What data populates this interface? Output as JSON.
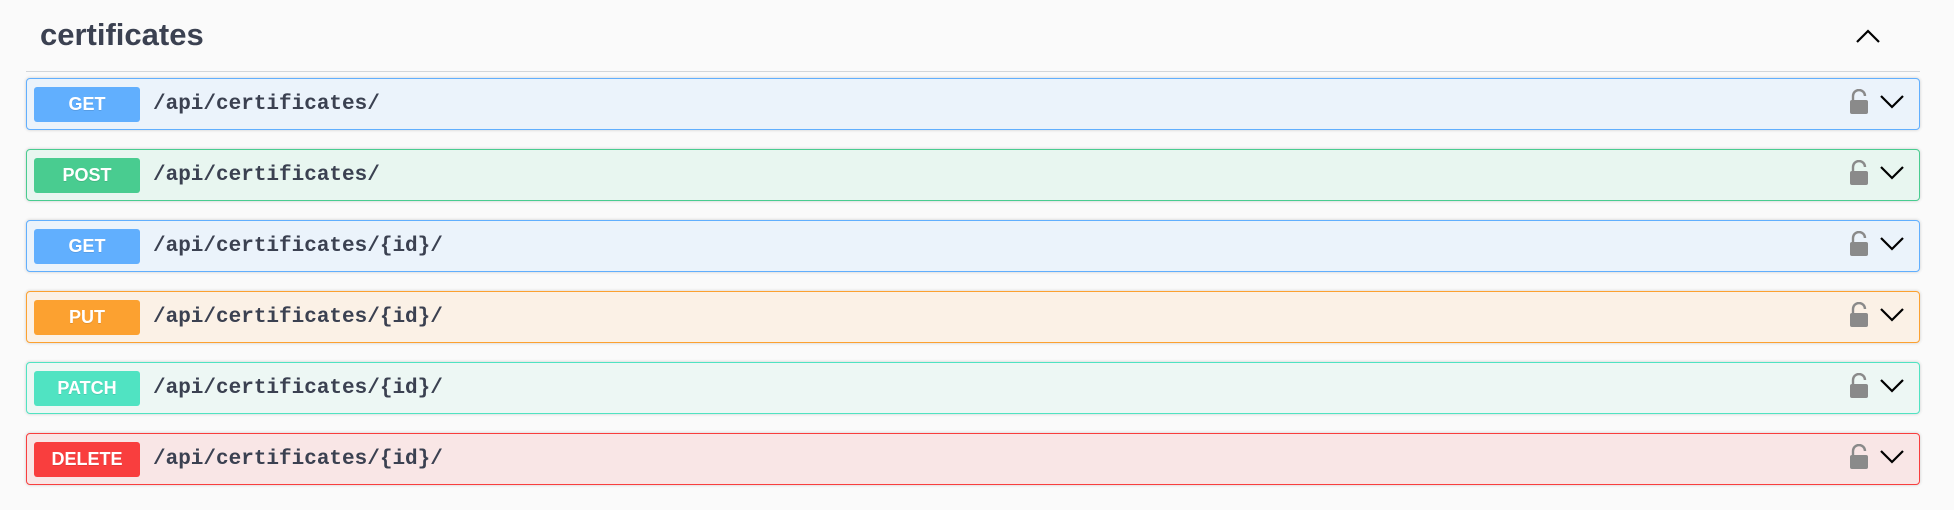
{
  "tag": {
    "title": "certificates"
  },
  "operations": [
    {
      "method": "GET",
      "path": "/api/certificates/",
      "color": "#61affe",
      "bg": "#ebf3fb",
      "border": "#61affe"
    },
    {
      "method": "POST",
      "path": "/api/certificates/",
      "color": "#49cc90",
      "bg": "#e8f6f0",
      "border": "#49cc90"
    },
    {
      "method": "GET",
      "path": "/api/certificates/{id}/",
      "color": "#61affe",
      "bg": "#ebf3fb",
      "border": "#61affe"
    },
    {
      "method": "PUT",
      "path": "/api/certificates/{id}/",
      "color": "#fca130",
      "bg": "#fbf1e6",
      "border": "#fca130"
    },
    {
      "method": "PATCH",
      "path": "/api/certificates/{id}/",
      "color": "#50e3c2",
      "bg": "#edf7f4",
      "border": "#50e3c2"
    },
    {
      "method": "DELETE",
      "path": "/api/certificates/{id}/",
      "color": "#f93e3e",
      "bg": "#f9e6e6",
      "border": "#f93e3e"
    }
  ],
  "icons": {
    "collapse": "chevron-up-icon",
    "lock": "lock-icon",
    "expand": "chevron-down-icon"
  }
}
